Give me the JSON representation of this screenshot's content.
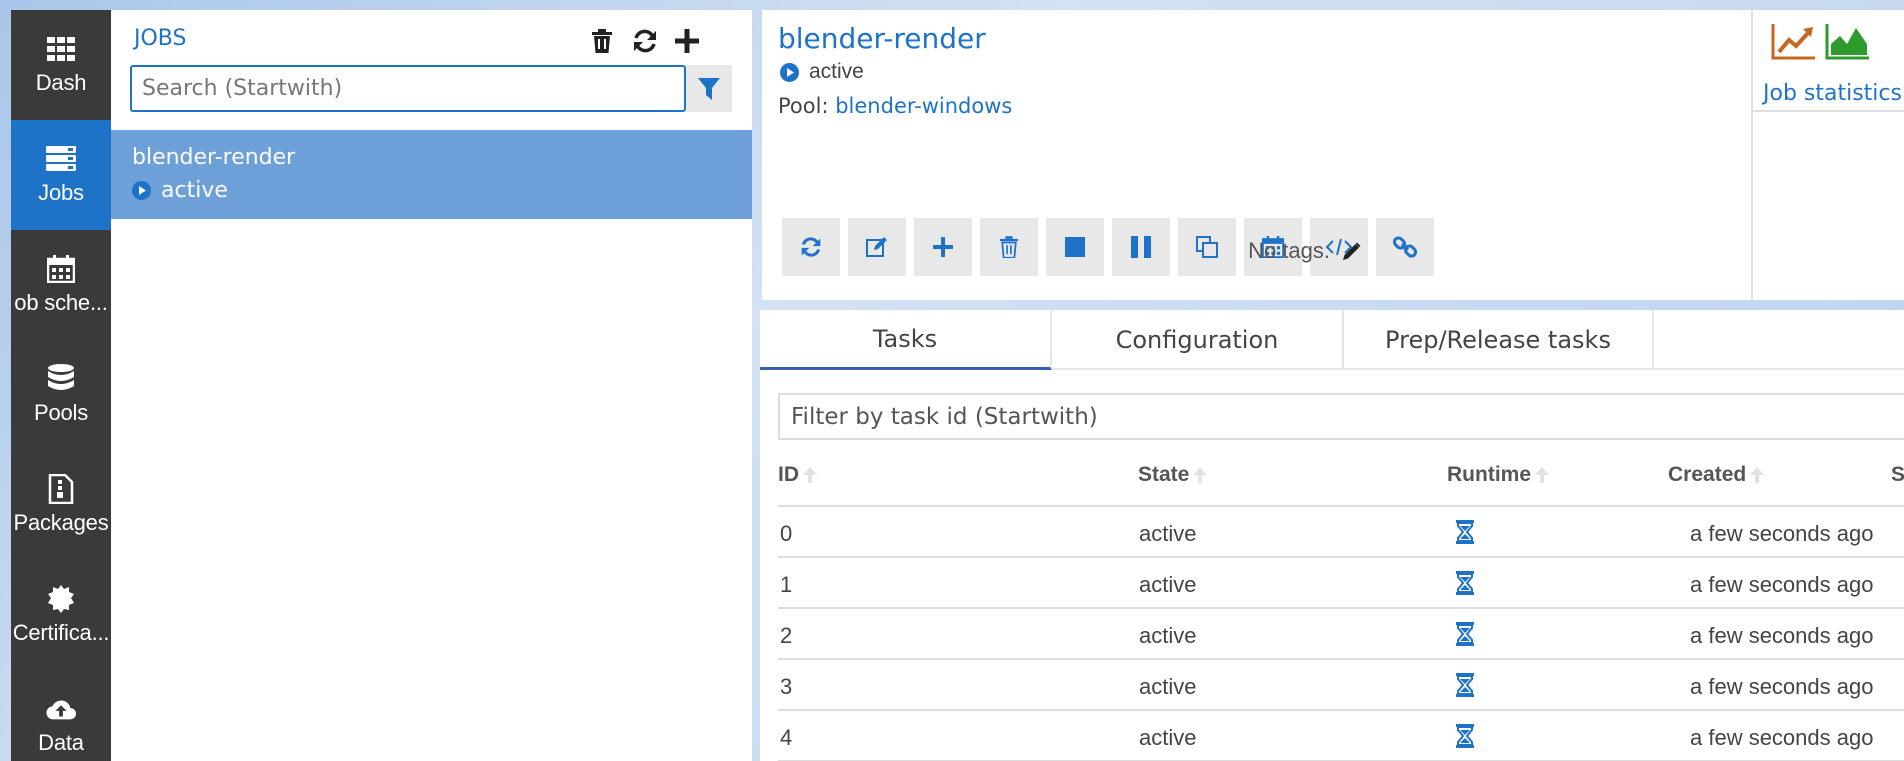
{
  "nav": {
    "items": [
      {
        "label": "Dash",
        "icon": "grid-icon",
        "active": false
      },
      {
        "label": "Jobs",
        "icon": "jobs-icon",
        "active": true
      },
      {
        "label": "ob sche...",
        "icon": "calendar-icon",
        "active": false
      },
      {
        "label": "Pools",
        "icon": "database-icon",
        "active": false
      },
      {
        "label": "Packages",
        "icon": "package-icon",
        "active": false
      },
      {
        "label": "Certifica...",
        "icon": "certificate-icon",
        "active": false
      },
      {
        "label": "Data",
        "icon": "cloud-upload-icon",
        "active": false
      }
    ]
  },
  "jobs_panel": {
    "title": "JOBS",
    "search_placeholder": "Search (Startwith)",
    "list": [
      {
        "name": "blender-render",
        "state": "active"
      }
    ]
  },
  "job_detail": {
    "title": "blender-render",
    "state": "active",
    "pool_label": "Pool:",
    "pool_name": "blender-windows",
    "tags_text": "No tags.",
    "toolbar_icons": [
      "refresh-icon",
      "edit-icon",
      "add-icon",
      "delete-icon",
      "stop-icon",
      "pause-icon",
      "clone-icon",
      "schedule-icon",
      "code-icon",
      "link-icon"
    ],
    "stats_label": "Job statistics"
  },
  "tabs": [
    "Tasks",
    "Configuration",
    "Prep/Release tasks"
  ],
  "tasks": {
    "filter_placeholder": "Filter by task id (Startwith)",
    "columns": [
      "ID",
      "State",
      "Runtime",
      "Created",
      "S"
    ],
    "rows": [
      {
        "id": "0",
        "state": "active",
        "created": "a few seconds ago"
      },
      {
        "id": "1",
        "state": "active",
        "created": "a few seconds ago"
      },
      {
        "id": "2",
        "state": "active",
        "created": "a few seconds ago"
      },
      {
        "id": "3",
        "state": "active",
        "created": "a few seconds ago"
      },
      {
        "id": "4",
        "state": "active",
        "created": "a few seconds ago"
      }
    ]
  },
  "colors": {
    "accent": "#1e73c8",
    "nav_bg": "#3a3a3a",
    "selected_row": "#6d9fd9",
    "stats_orange": "#c8661e",
    "stats_green": "#2e9a2e"
  }
}
